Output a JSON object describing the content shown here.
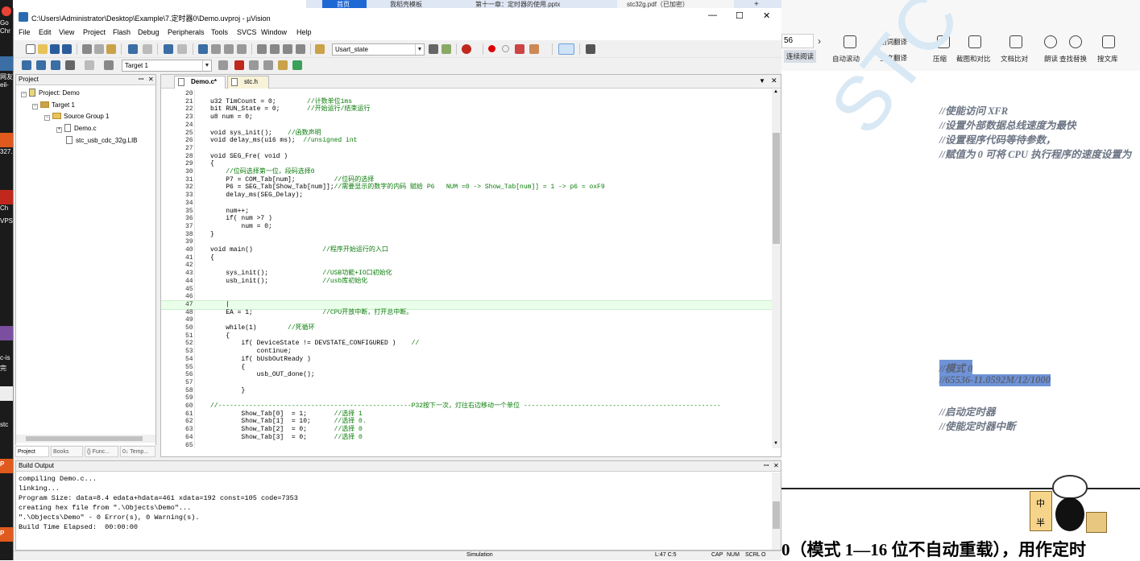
{
  "window": {
    "title": "C:\\Users\\Administrator\\Desktop\\Example\\7.定时器0\\Demo.uvproj - µVision",
    "controls": [
      "—",
      "☐",
      "✕"
    ]
  },
  "browser_tabs": [
    "首页",
    "我稻壳模板",
    "第十一章：定时器的使用.pptx",
    "stc32g.pdf（已加密）",
    "+"
  ],
  "menu": [
    "File",
    "Edit",
    "View",
    "Project",
    "Flash",
    "Debug",
    "Peripherals",
    "Tools",
    "SVCS",
    "Window",
    "Help"
  ],
  "toolbar": {
    "find_combo": "Usart_state",
    "target_combo": "Target 1"
  },
  "project_panel": {
    "title": "Project",
    "tree": [
      {
        "label": "Project: Demo"
      },
      {
        "label": "Target 1"
      },
      {
        "label": "Source Group 1"
      },
      {
        "label": "Demo.c"
      },
      {
        "label": "stc_usb_cdc_32g.LIB"
      }
    ],
    "tabs": [
      "Project",
      "Books",
      "{} Func...",
      "0↓ Temp..."
    ]
  },
  "editor": {
    "tabs": [
      "Demo.c*",
      "stc.h"
    ],
    "lines": [
      {
        "n": "20",
        "t": ""
      },
      {
        "n": "21",
        "t": "u32 TimCount = 0;",
        "c": "        //计数单位1ms"
      },
      {
        "n": "22",
        "t": "bit RUN_State = 0;",
        "c": "       //开始运行/结束运行"
      },
      {
        "n": "23",
        "t": "u8 num = 0;",
        "c": ""
      },
      {
        "n": "24",
        "t": "",
        "c": ""
      },
      {
        "n": "25",
        "t": "void sys_init();",
        "c": "    //函数声明"
      },
      {
        "n": "26",
        "t": "void delay_ms(u16 ms);",
        "c": "  //unsigned int"
      },
      {
        "n": "27",
        "t": "",
        "c": ""
      },
      {
        "n": "28",
        "t": "void SEG_Fre( void )",
        "c": ""
      },
      {
        "n": "29",
        "t": "{",
        "c": ""
      },
      {
        "n": "30",
        "t": "    ",
        "c": "//位码选择第一位，段码选择0"
      },
      {
        "n": "31",
        "t": "    P7 = COM_Tab[num];",
        "c": "          //位码的选择"
      },
      {
        "n": "32",
        "t": "    P6 = SEG_Tab[Show_Tab[num]];",
        "c": "//需要显示的数字的内码 赋给 P6   NUM =0 -> Show_Tab[num]] = 1 -> p6 = oxF9"
      },
      {
        "n": "33",
        "t": "    delay_ms(SEG_Delay);",
        "c": ""
      },
      {
        "n": "34",
        "t": "",
        "c": ""
      },
      {
        "n": "35",
        "t": "    num++;",
        "c": ""
      },
      {
        "n": "36",
        "t": "    if( num >7 )",
        "c": ""
      },
      {
        "n": "37",
        "t": "        num = 0;",
        "c": ""
      },
      {
        "n": "38",
        "t": "}",
        "c": ""
      },
      {
        "n": "39",
        "t": "",
        "c": ""
      },
      {
        "n": "40",
        "t": "void main()",
        "c": "                  //程序开始运行的入口"
      },
      {
        "n": "41",
        "t": "{",
        "c": ""
      },
      {
        "n": "42",
        "t": "",
        "c": ""
      },
      {
        "n": "43",
        "t": "    sys_init();",
        "c": "              //USB功能+IO口初始化"
      },
      {
        "n": "44",
        "t": "    usb_init();",
        "c": "              //usb库初始化"
      },
      {
        "n": "45",
        "t": "",
        "c": ""
      },
      {
        "n": "46",
        "t": "",
        "c": ""
      },
      {
        "n": "47",
        "t": "    |",
        "c": ""
      },
      {
        "n": "48",
        "t": "    EA = 1;",
        "c": "                  //CPU开放中断，打开总中断。"
      },
      {
        "n": "49",
        "t": "",
        "c": ""
      },
      {
        "n": "50",
        "t": "    while(1)",
        "c": "        //死循环"
      },
      {
        "n": "51",
        "t": "    {",
        "c": ""
      },
      {
        "n": "52",
        "t": "        if( DeviceState != DEVSTATE_CONFIGURED )",
        "c": "    //"
      },
      {
        "n": "53",
        "t": "            continue;",
        "c": ""
      },
      {
        "n": "54",
        "t": "        if( bUsbOutReady )",
        "c": ""
      },
      {
        "n": "55",
        "t": "        {",
        "c": ""
      },
      {
        "n": "56",
        "t": "            usb_OUT_done();",
        "c": ""
      },
      {
        "n": "57",
        "t": "",
        "c": ""
      },
      {
        "n": "58",
        "t": "        }",
        "c": ""
      },
      {
        "n": "59",
        "t": "",
        "c": ""
      },
      {
        "n": "60",
        "t": "",
        "c": "//--------------------------------------------------P32按下一次，灯往右边移动一个单位 ---------------------------------------------------"
      },
      {
        "n": "61",
        "t": "        Show_Tab[0]  = 1;",
        "c": "       //选择 1"
      },
      {
        "n": "62",
        "t": "        Show_Tab[1]  = 10;",
        "c": "      //选择 0."
      },
      {
        "n": "63",
        "t": "        Show_Tab[2]  = 0;",
        "c": "       //选择 0"
      },
      {
        "n": "64",
        "t": "        Show_Tab[3]  = 0;",
        "c": "       //选择 0"
      },
      {
        "n": "65",
        "t": "",
        "c": ""
      }
    ]
  },
  "build_output": {
    "title": "Build Output",
    "lines": [
      "compiling Demo.c...",
      "linking...",
      "Program Size: data=8.4 edata+hdata=461 xdata=192 const=105 code=7353",
      "creating hex file from \".\\Objects\\Demo\"...",
      "\".\\Objects\\Demo\" - 0 Error(s), 0 Warning(s).",
      "Build Time Elapsed:  00:00:00"
    ]
  },
  "status_bar": {
    "mode": "Simulation",
    "position": "L:47 C:5",
    "indicators": [
      "CAP",
      "NUM",
      "SCRL",
      "O"
    ]
  },
  "pdf_viewer": {
    "page_field": "56",
    "tools": [
      "划词翻译",
      "全文翻译",
      "压缩",
      "截图和对比",
      "文档比对",
      "朗读",
      "查找替换",
      "搜文库",
      "连续阅读",
      "自动滚动"
    ],
    "comments": [
      "//使能访问 XFR",
      "//设置外部数据总线速度为最快",
      "//设置程序代码等待参数，",
      "//赋值为 0 可将 CPU 执行程序的速度设置为",
      "//模式 0",
      "//65536-11.0592M/12/1000",
      "//启动定时器",
      "//使能定时器中断"
    ],
    "watermark": "STC MCU",
    "bottom_text": "0（模式 1—16 位不自动重载），用作定时",
    "mascot_text": [
      "中",
      "半"
    ]
  },
  "desktop_labels": [
    "Go",
    "Chr",
    "网友",
    "eil-",
    "327.",
    "Ch",
    "VPS",
    "c-is",
    "完",
    "stc",
    "P",
    "P"
  ]
}
